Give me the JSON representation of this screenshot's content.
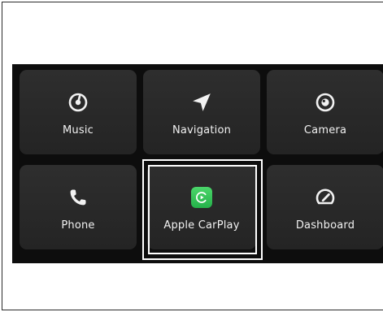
{
  "apps": [
    {
      "label": "Music",
      "icon": "music-icon"
    },
    {
      "label": "Navigation",
      "icon": "navigation-arrow-icon"
    },
    {
      "label": "Camera",
      "icon": "camera-icon"
    },
    {
      "label": "Phone",
      "icon": "phone-icon"
    },
    {
      "label": "Apple CarPlay",
      "icon": "carplay-icon",
      "selected": true,
      "icon_color": "#34c759"
    },
    {
      "label": "Dashboard",
      "icon": "speedometer-icon"
    }
  ],
  "colors": {
    "screen_background": "#0d0d0d",
    "tile_background": "#2a2a2a",
    "label": "#f2f2f2",
    "selection_border": "#ffffff",
    "carplay_green": "#34c759"
  }
}
